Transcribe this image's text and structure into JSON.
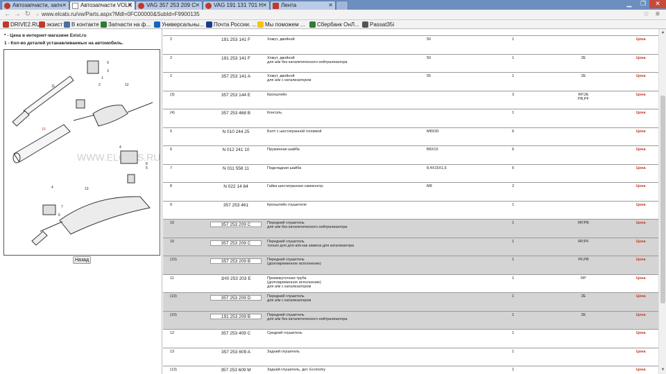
{
  "browser": {
    "tabs": [
      {
        "title": "Автозапчасти, запч",
        "active": false
      },
      {
        "title": "Автозапчасти VOLK",
        "active": true
      },
      {
        "title": "VAG 357 253 209 C",
        "active": false
      },
      {
        "title": "VAG 191 131 701 H",
        "active": false
      },
      {
        "title": "Лента",
        "active": false
      }
    ],
    "url": "www.elcats.ru/vw/Parts.aspx?Mdl=0FC00000&SubId=F9900135",
    "bookmarks": [
      {
        "label": "DRIVE2.RU",
        "color": "#c0392b"
      },
      {
        "label": "экзист",
        "color": "#c0392b"
      },
      {
        "label": "В контакте",
        "color": "#4a6f9c"
      },
      {
        "label": "Запчасти на ф...",
        "color": "#2e7d32"
      },
      {
        "label": "Универсальны...",
        "color": "#1565c0"
      },
      {
        "label": "Почта России. ...",
        "color": "#1a3a8c"
      },
      {
        "label": "Мы поможем ...",
        "color": "#f1c40f"
      },
      {
        "label": "Сбербанк ОнЛ...",
        "color": "#2e7d32"
      },
      {
        "label": "Passat35i",
        "color": "#555555"
      }
    ]
  },
  "left": {
    "note1": "* - Цена в интернет-магазине Exist.ru",
    "note2": "1 - Кол-во деталей устанавливаемых на автомобиль.",
    "watermark": "WWW.ELCATS.RU",
    "back_label": "Назад",
    "callouts": [
      "9",
      "3",
      "1",
      "2",
      "11",
      "12",
      "10",
      "4",
      "8",
      "5",
      "13",
      "7",
      "6"
    ]
  },
  "parts": [
    {
      "pos": "2",
      "number": "191 253 141 F",
      "name": "Хомут, двойной",
      "qty": "50",
      "amount": "1",
      "model": "",
      "price": "Цена",
      "grey": false,
      "boxed": false
    },
    {
      "pos": "2",
      "number": "191 253 141 F",
      "name": "Хомут, двойной\nдля а/м без каталитического нейтрализатора",
      "qty": "50",
      "amount": "1",
      "model": "2E",
      "price": "Цена",
      "grey": false,
      "boxed": false
    },
    {
      "pos": "2",
      "number": "357 253 141 A",
      "name": "Хомут, двойной\nдля а/м с катализатором",
      "qty": "55",
      "amount": "1",
      "model": "2E",
      "price": "Цена",
      "grey": false,
      "boxed": false
    },
    {
      "pos": "(3)",
      "number": "357 253 144 E",
      "name": "Кронштейн",
      "qty": "",
      "amount": "3",
      "model": "RP,2E\nPB,PF",
      "price": "Цена",
      "grey": false,
      "boxed": false
    },
    {
      "pos": "(4)",
      "number": "357 253 468 B",
      "name": "Консоль",
      "qty": "",
      "amount": "1",
      "model": "",
      "price": "Цена",
      "grey": false,
      "boxed": false
    },
    {
      "pos": "5",
      "number": "N 010 244 25",
      "name": "Болт с шестигранной головкой",
      "qty": "M8X30",
      "amount": "6",
      "model": "",
      "price": "Цена",
      "grey": false,
      "boxed": false
    },
    {
      "pos": "6",
      "number": "N 012 241 10",
      "name": "Пружинная шайба",
      "qty": "B8X15",
      "amount": "6",
      "model": "",
      "price": "Цена",
      "grey": false,
      "boxed": false
    },
    {
      "pos": "7",
      "number": "N 011 558 11",
      "name": "Подкладная шайба",
      "qty": "8,4X15X1,6",
      "amount": "6",
      "model": "",
      "price": "Цена",
      "grey": false,
      "boxed": false
    },
    {
      "pos": "8",
      "number": "N 022 14 64",
      "name": "Гайка шестигранная самоконтр.",
      "qty": "M8",
      "amount": "2",
      "model": "",
      "price": "Цена",
      "grey": false,
      "boxed": false
    },
    {
      "pos": "9",
      "number": "357 253 461",
      "name": "Кронштейн глушителя",
      "qty": "",
      "amount": "1",
      "model": "",
      "price": "Цена",
      "grey": false,
      "boxed": false
    },
    {
      "pos": "10",
      "number": "357 253 209 C",
      "name": "Передний глушитель\nдля а/м без каталитического нейтрализатора",
      "qty": "",
      "amount": "1",
      "model": "RP,PB",
      "price": "Цена",
      "grey": true,
      "boxed": true
    },
    {
      "pos": "10",
      "number": "357 253 209 C",
      "name": "Передний глушитель\nтолько для для а/м как замена для катализатора",
      "qty": "",
      "amount": "1",
      "model": "RP,PF",
      "price": "Цена",
      "grey": true,
      "boxed": true
    },
    {
      "pos": "(10)",
      "number": "357 253 209 B",
      "name": "Передний глушитель\n(долговременное исполнение)",
      "qty": "",
      "amount": "1",
      "model": "PF,PB",
      "price": "Цена",
      "grey": true,
      "boxed": true
    },
    {
      "pos": "11",
      "number": "1H0 253 203 E",
      "name": "Промежуточная труба\n(долговременное исполнение)\nдля а/м с катализатором",
      "qty": "",
      "amount": "1",
      "model": "RP",
      "price": "Цена",
      "grey": false,
      "boxed": false
    },
    {
      "pos": "(10)",
      "number": "357 253 209 D",
      "name": "Передний глушитель\nдля а/м с катализатором",
      "qty": "",
      "amount": "1",
      "model": "2E",
      "price": "Цена",
      "grey": true,
      "boxed": true
    },
    {
      "pos": "(10)",
      "number": "191 253 209 B",
      "name": "Передний глушитель\nдля а/м без каталитического нейтрализатора",
      "qty": "",
      "amount": "1",
      "model": "2E",
      "price": "Цена",
      "grey": true,
      "boxed": true
    },
    {
      "pos": "12",
      "number": "357 253 409 C",
      "name": "Средний глушитель",
      "qty": "",
      "amount": "1",
      "model": "",
      "price": "Цена",
      "grey": false,
      "boxed": false
    },
    {
      "pos": "13",
      "number": "357 253 609 A",
      "name": "Задний глушитель",
      "qty": "",
      "amount": "1",
      "model": "",
      "price": "Цена",
      "grey": false,
      "boxed": false
    },
    {
      "pos": "(13)",
      "number": "357 253 609 M",
      "name": "Задний глушитель, дет. Economy",
      "qty": "",
      "amount": "1",
      "model": "",
      "price": "Цена",
      "grey": false,
      "boxed": false
    }
  ]
}
